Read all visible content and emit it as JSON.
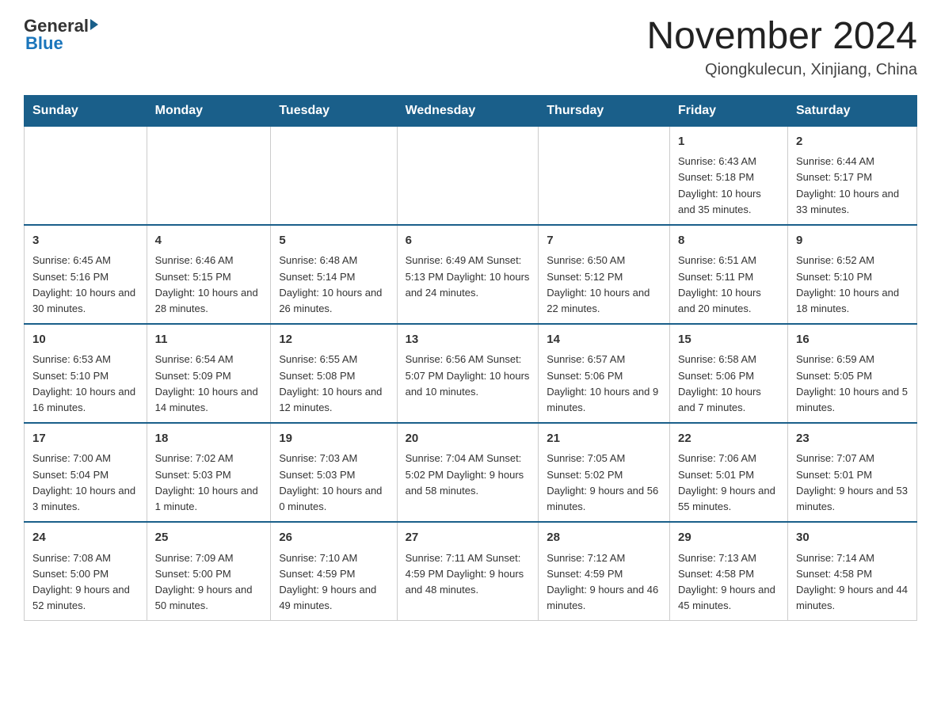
{
  "logo": {
    "general": "General",
    "blue": "Blue"
  },
  "title": "November 2024",
  "location": "Qiongkulecun, Xinjiang, China",
  "days_header": [
    "Sunday",
    "Monday",
    "Tuesday",
    "Wednesday",
    "Thursday",
    "Friday",
    "Saturday"
  ],
  "weeks": [
    [
      {
        "day": "",
        "info": ""
      },
      {
        "day": "",
        "info": ""
      },
      {
        "day": "",
        "info": ""
      },
      {
        "day": "",
        "info": ""
      },
      {
        "day": "",
        "info": ""
      },
      {
        "day": "1",
        "info": "Sunrise: 6:43 AM\nSunset: 5:18 PM\nDaylight: 10 hours and 35 minutes."
      },
      {
        "day": "2",
        "info": "Sunrise: 6:44 AM\nSunset: 5:17 PM\nDaylight: 10 hours and 33 minutes."
      }
    ],
    [
      {
        "day": "3",
        "info": "Sunrise: 6:45 AM\nSunset: 5:16 PM\nDaylight: 10 hours and 30 minutes."
      },
      {
        "day": "4",
        "info": "Sunrise: 6:46 AM\nSunset: 5:15 PM\nDaylight: 10 hours and 28 minutes."
      },
      {
        "day": "5",
        "info": "Sunrise: 6:48 AM\nSunset: 5:14 PM\nDaylight: 10 hours and 26 minutes."
      },
      {
        "day": "6",
        "info": "Sunrise: 6:49 AM\nSunset: 5:13 PM\nDaylight: 10 hours and 24 minutes."
      },
      {
        "day": "7",
        "info": "Sunrise: 6:50 AM\nSunset: 5:12 PM\nDaylight: 10 hours and 22 minutes."
      },
      {
        "day": "8",
        "info": "Sunrise: 6:51 AM\nSunset: 5:11 PM\nDaylight: 10 hours and 20 minutes."
      },
      {
        "day": "9",
        "info": "Sunrise: 6:52 AM\nSunset: 5:10 PM\nDaylight: 10 hours and 18 minutes."
      }
    ],
    [
      {
        "day": "10",
        "info": "Sunrise: 6:53 AM\nSunset: 5:10 PM\nDaylight: 10 hours and 16 minutes."
      },
      {
        "day": "11",
        "info": "Sunrise: 6:54 AM\nSunset: 5:09 PM\nDaylight: 10 hours and 14 minutes."
      },
      {
        "day": "12",
        "info": "Sunrise: 6:55 AM\nSunset: 5:08 PM\nDaylight: 10 hours and 12 minutes."
      },
      {
        "day": "13",
        "info": "Sunrise: 6:56 AM\nSunset: 5:07 PM\nDaylight: 10 hours and 10 minutes."
      },
      {
        "day": "14",
        "info": "Sunrise: 6:57 AM\nSunset: 5:06 PM\nDaylight: 10 hours and 9 minutes."
      },
      {
        "day": "15",
        "info": "Sunrise: 6:58 AM\nSunset: 5:06 PM\nDaylight: 10 hours and 7 minutes."
      },
      {
        "day": "16",
        "info": "Sunrise: 6:59 AM\nSunset: 5:05 PM\nDaylight: 10 hours and 5 minutes."
      }
    ],
    [
      {
        "day": "17",
        "info": "Sunrise: 7:00 AM\nSunset: 5:04 PM\nDaylight: 10 hours and 3 minutes."
      },
      {
        "day": "18",
        "info": "Sunrise: 7:02 AM\nSunset: 5:03 PM\nDaylight: 10 hours and 1 minute."
      },
      {
        "day": "19",
        "info": "Sunrise: 7:03 AM\nSunset: 5:03 PM\nDaylight: 10 hours and 0 minutes."
      },
      {
        "day": "20",
        "info": "Sunrise: 7:04 AM\nSunset: 5:02 PM\nDaylight: 9 hours and 58 minutes."
      },
      {
        "day": "21",
        "info": "Sunrise: 7:05 AM\nSunset: 5:02 PM\nDaylight: 9 hours and 56 minutes."
      },
      {
        "day": "22",
        "info": "Sunrise: 7:06 AM\nSunset: 5:01 PM\nDaylight: 9 hours and 55 minutes."
      },
      {
        "day": "23",
        "info": "Sunrise: 7:07 AM\nSunset: 5:01 PM\nDaylight: 9 hours and 53 minutes."
      }
    ],
    [
      {
        "day": "24",
        "info": "Sunrise: 7:08 AM\nSunset: 5:00 PM\nDaylight: 9 hours and 52 minutes."
      },
      {
        "day": "25",
        "info": "Sunrise: 7:09 AM\nSunset: 5:00 PM\nDaylight: 9 hours and 50 minutes."
      },
      {
        "day": "26",
        "info": "Sunrise: 7:10 AM\nSunset: 4:59 PM\nDaylight: 9 hours and 49 minutes."
      },
      {
        "day": "27",
        "info": "Sunrise: 7:11 AM\nSunset: 4:59 PM\nDaylight: 9 hours and 48 minutes."
      },
      {
        "day": "28",
        "info": "Sunrise: 7:12 AM\nSunset: 4:59 PM\nDaylight: 9 hours and 46 minutes."
      },
      {
        "day": "29",
        "info": "Sunrise: 7:13 AM\nSunset: 4:58 PM\nDaylight: 9 hours and 45 minutes."
      },
      {
        "day": "30",
        "info": "Sunrise: 7:14 AM\nSunset: 4:58 PM\nDaylight: 9 hours and 44 minutes."
      }
    ]
  ]
}
